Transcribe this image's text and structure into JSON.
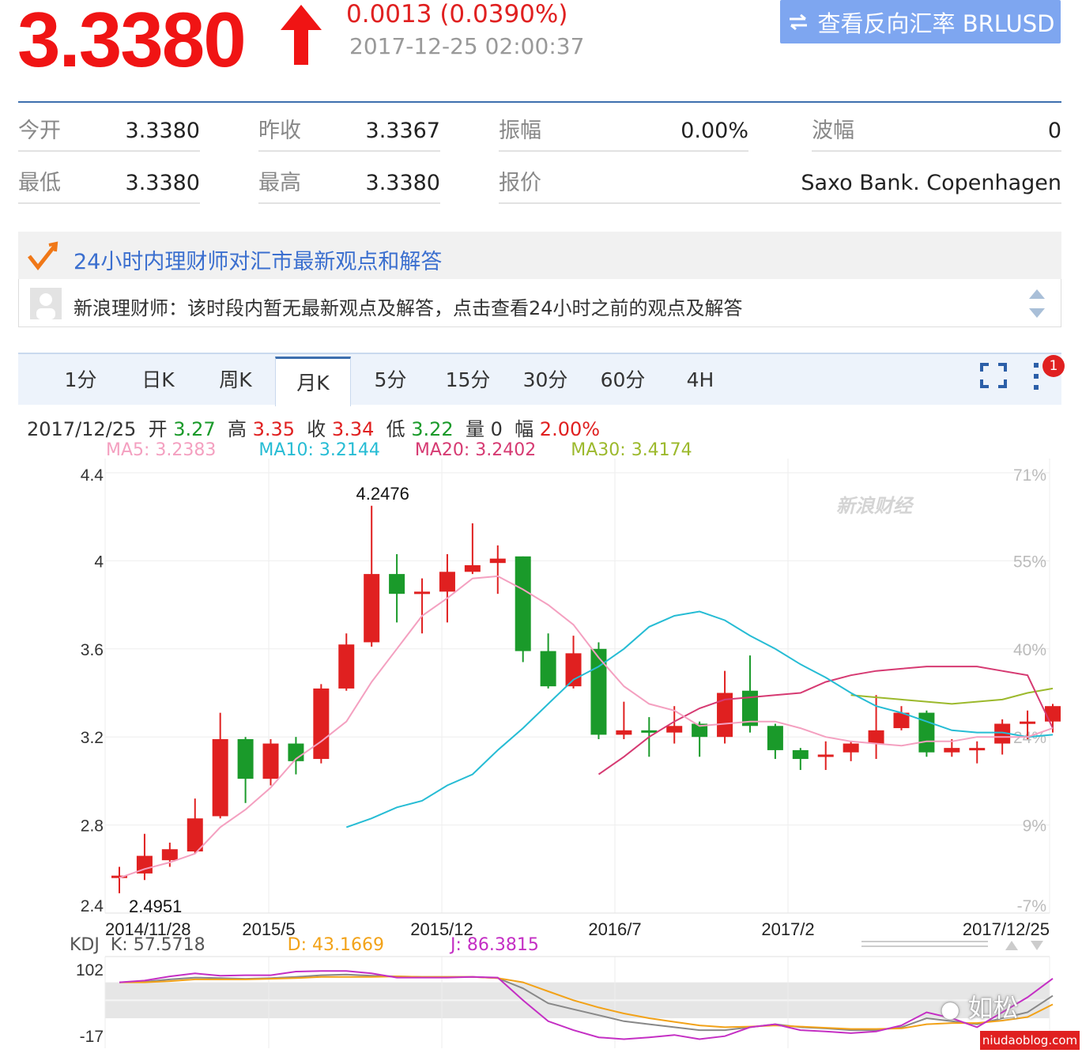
{
  "quote": {
    "price": "3.3380",
    "change": "0.0013 (0.0390%)",
    "timestamp": "2017-12-25 02:00:37",
    "reverse_button": "查看反向汇率 BRLUSD",
    "direction": "up"
  },
  "stats": [
    {
      "label": "今开",
      "value": "3.3380"
    },
    {
      "label": "昨收",
      "value": "3.3367"
    },
    {
      "label": "振幅",
      "value": "0.00%"
    },
    {
      "label": "波幅",
      "value": "0"
    },
    {
      "label": "最低",
      "value": "3.3380"
    },
    {
      "label": "最高",
      "value": "3.3380"
    },
    {
      "label": "报价",
      "value": "Saxo Bank. Copenhagen"
    }
  ],
  "analyst": {
    "title": "24小时内理财师对汇市最新观点和解答",
    "message": "新浪理财师：该时段内暂无最新观点及解答，点击查看24小时之前的观点及解答"
  },
  "tabs": [
    "1分",
    "日K",
    "周K",
    "月K",
    "5分",
    "15分",
    "30分",
    "60分",
    "4H"
  ],
  "active_tab": "月K",
  "notification_count": "1",
  "info": {
    "date": "2017/12/25",
    "open_label": "开",
    "open": "3.27",
    "high_label": "高",
    "high": "3.35",
    "close_label": "收",
    "close": "3.34",
    "low_label": "低",
    "low": "3.22",
    "volume_label": "量",
    "volume": "0",
    "amp_label": "幅",
    "amp": "2.00%"
  },
  "ma": {
    "ma5": "MA5: 3.2383",
    "ma10": "MA10: 3.2144",
    "ma20": "MA20: 3.2402",
    "ma30": "MA30: 3.4174"
  },
  "kdj": {
    "label": "KDJ",
    "k": "K: 57.5718",
    "d": "D: 43.1669",
    "j": "J: 86.3815"
  },
  "watermark": {
    "sina": "新浪财经",
    "author": "如松",
    "site": "niudaoblog.com"
  },
  "colors": {
    "up": "#e02020",
    "down": "#1a9a2a",
    "ma5": "#f4a0c0",
    "ma10": "#26bcd4",
    "ma20": "#d63a72",
    "ma30": "#9cb92c",
    "k": "#888888",
    "d": "#f2a218",
    "j": "#c42fc4"
  },
  "chart_data": {
    "type": "candlestick",
    "title": "",
    "yticks": [
      "4.4",
      "4",
      "3.6",
      "3.2",
      "2.8",
      "2.4"
    ],
    "ylim": [
      2.4,
      4.4
    ],
    "pct_ticks": [
      "71%",
      "55%",
      "40%",
      "24%",
      "9%",
      "-7%"
    ],
    "xticks": [
      "2014/11/28",
      "2015/5",
      "2015/12",
      "2016/7",
      "2017/2",
      "2017/12/25"
    ],
    "annotations": [
      "4.2476",
      "2.4951"
    ],
    "candles": [
      {
        "o": 2.56,
        "c": 2.57,
        "h": 2.61,
        "l": 2.49
      },
      {
        "o": 2.58,
        "c": 2.66,
        "h": 2.76,
        "l": 2.55
      },
      {
        "o": 2.64,
        "c": 2.69,
        "h": 2.72,
        "l": 2.61
      },
      {
        "o": 2.68,
        "c": 2.83,
        "h": 2.92,
        "l": 2.67
      },
      {
        "o": 2.84,
        "c": 3.19,
        "h": 3.31,
        "l": 2.83
      },
      {
        "o": 3.19,
        "c": 3.01,
        "h": 3.2,
        "l": 2.9
      },
      {
        "o": 3.01,
        "c": 3.17,
        "h": 3.19,
        "l": 2.98
      },
      {
        "o": 3.17,
        "c": 3.09,
        "h": 3.2,
        "l": 3.03
      },
      {
        "o": 3.1,
        "c": 3.42,
        "h": 3.44,
        "l": 3.08
      },
      {
        "o": 3.42,
        "c": 3.62,
        "h": 3.67,
        "l": 3.41
      },
      {
        "o": 3.63,
        "c": 3.94,
        "h": 4.25,
        "l": 3.61
      },
      {
        "o": 3.94,
        "c": 3.85,
        "h": 4.03,
        "l": 3.72
      },
      {
        "o": 3.85,
        "c": 3.86,
        "h": 3.92,
        "l": 3.67
      },
      {
        "o": 3.86,
        "c": 3.95,
        "h": 4.03,
        "l": 3.72
      },
      {
        "o": 3.95,
        "c": 3.98,
        "h": 4.17,
        "l": 3.94
      },
      {
        "o": 3.99,
        "c": 4.01,
        "h": 4.07,
        "l": 3.85
      },
      {
        "o": 4.02,
        "c": 3.59,
        "h": 4.02,
        "l": 3.54
      },
      {
        "o": 3.59,
        "c": 3.43,
        "h": 3.67,
        "l": 3.42
      },
      {
        "o": 3.43,
        "c": 3.58,
        "h": 3.66,
        "l": 3.42
      },
      {
        "o": 3.6,
        "c": 3.21,
        "h": 3.63,
        "l": 3.19
      },
      {
        "o": 3.21,
        "c": 3.23,
        "h": 3.36,
        "l": 3.19
      },
      {
        "o": 3.23,
        "c": 3.22,
        "h": 3.29,
        "l": 3.11
      },
      {
        "o": 3.22,
        "c": 3.25,
        "h": 3.34,
        "l": 3.17
      },
      {
        "o": 3.26,
        "c": 3.2,
        "h": 3.27,
        "l": 3.11
      },
      {
        "o": 3.2,
        "c": 3.4,
        "h": 3.5,
        "l": 3.17
      },
      {
        "o": 3.41,
        "c": 3.25,
        "h": 3.57,
        "l": 3.22
      },
      {
        "o": 3.25,
        "c": 3.14,
        "h": 3.26,
        "l": 3.1
      },
      {
        "o": 3.14,
        "c": 3.1,
        "h": 3.15,
        "l": 3.05
      },
      {
        "o": 3.11,
        "c": 3.12,
        "h": 3.18,
        "l": 3.05
      },
      {
        "o": 3.13,
        "c": 3.17,
        "h": 3.18,
        "l": 3.09
      },
      {
        "o": 3.17,
        "c": 3.23,
        "h": 3.39,
        "l": 3.1
      },
      {
        "o": 3.24,
        "c": 3.31,
        "h": 3.34,
        "l": 3.23
      },
      {
        "o": 3.31,
        "c": 3.13,
        "h": 3.32,
        "l": 3.11
      },
      {
        "o": 3.13,
        "c": 3.15,
        "h": 3.19,
        "l": 3.11
      },
      {
        "o": 3.14,
        "c": 3.15,
        "h": 3.18,
        "l": 3.08
      },
      {
        "o": 3.17,
        "c": 3.26,
        "h": 3.28,
        "l": 3.12
      },
      {
        "o": 3.27,
        "c": 3.27,
        "h": 3.32,
        "l": 3.19
      },
      {
        "o": 3.27,
        "c": 3.34,
        "h": 3.35,
        "l": 3.22
      }
    ],
    "ma5": [
      2.56,
      2.6,
      2.63,
      2.67,
      2.79,
      2.87,
      2.97,
      3.1,
      3.18,
      3.27,
      3.45,
      3.6,
      3.75,
      3.83,
      3.92,
      3.93,
      3.87,
      3.8,
      3.71,
      3.56,
      3.43,
      3.35,
      3.32,
      3.25,
      3.26,
      3.27,
      3.27,
      3.24,
      3.2,
      3.18,
      3.17,
      3.16,
      3.18,
      3.18,
      3.2,
      3.2,
      3.2,
      3.24
    ],
    "ma10": [
      null,
      null,
      null,
      null,
      null,
      null,
      null,
      null,
      null,
      2.79,
      2.83,
      2.88,
      2.91,
      2.98,
      3.03,
      3.14,
      3.24,
      3.35,
      3.46,
      3.52,
      3.6,
      3.7,
      3.75,
      3.77,
      3.73,
      3.66,
      3.6,
      3.53,
      3.47,
      3.4,
      3.34,
      3.31,
      3.27,
      3.23,
      3.22,
      3.22,
      3.2,
      3.21
    ],
    "ma20": [
      null,
      null,
      null,
      null,
      null,
      null,
      null,
      null,
      null,
      null,
      null,
      null,
      null,
      null,
      null,
      null,
      null,
      null,
      null,
      3.03,
      3.11,
      3.2,
      3.27,
      3.33,
      3.37,
      3.38,
      3.39,
      3.4,
      3.45,
      3.48,
      3.5,
      3.51,
      3.52,
      3.52,
      3.52,
      3.5,
      3.48,
      3.24
    ],
    "ma30": [
      null,
      null,
      null,
      null,
      null,
      null,
      null,
      null,
      null,
      null,
      null,
      null,
      null,
      null,
      null,
      null,
      null,
      null,
      null,
      null,
      null,
      null,
      null,
      null,
      null,
      null,
      null,
      null,
      null,
      3.39,
      3.38,
      3.37,
      3.36,
      3.35,
      3.36,
      3.37,
      3.4,
      3.42
    ],
    "kdj_yticks": [
      "102",
      "-17"
    ],
    "kdj_ylim": [
      -17,
      102
    ],
    "k": [
      80,
      81,
      85,
      88,
      87,
      86,
      87,
      89,
      92,
      93,
      91,
      90,
      89,
      89,
      89,
      87,
      70,
      45,
      35,
      25,
      15,
      10,
      5,
      0,
      0,
      5,
      10,
      5,
      3,
      0,
      0,
      5,
      20,
      15,
      10,
      20,
      30,
      57.6
    ],
    "d": [
      80,
      80,
      82,
      85,
      85,
      85,
      86,
      87,
      89,
      89,
      89,
      90,
      89,
      89,
      89,
      87,
      80,
      65,
      50,
      38,
      28,
      20,
      14,
      8,
      5,
      6,
      8,
      6,
      4,
      2,
      2,
      3,
      10,
      12,
      12,
      16,
      22,
      43.2
    ],
    "j": [
      80,
      83,
      90,
      95,
      91,
      92,
      92,
      98,
      99,
      99,
      95,
      88,
      88,
      88,
      89,
      88,
      50,
      15,
      0,
      -12,
      -15,
      -12,
      -8,
      -15,
      -10,
      5,
      10,
      0,
      -2,
      -5,
      -2,
      8,
      30,
      20,
      5,
      30,
      55,
      86.4
    ]
  }
}
